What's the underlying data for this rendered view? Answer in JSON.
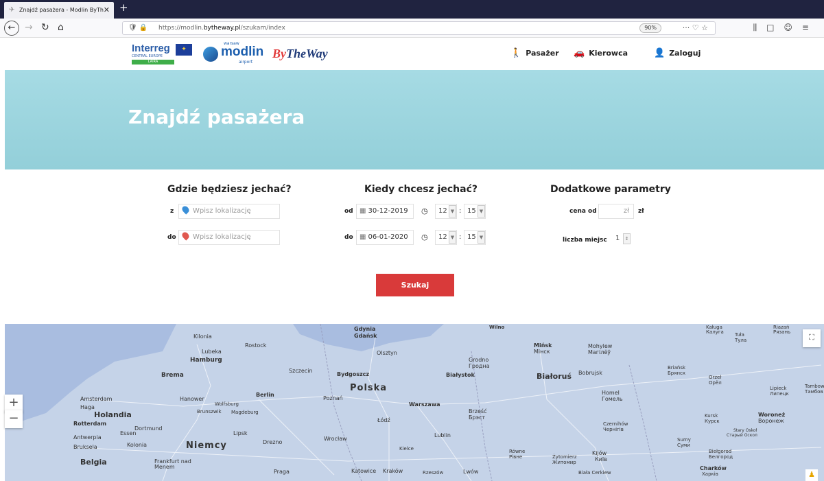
{
  "browser": {
    "tab_title": "Znajdź pasażera - Modlin ByTh",
    "url_prefix": "https://modlin.",
    "url_domain": "bytheway.pl",
    "url_path": "/szukam/index",
    "zoom": "90%"
  },
  "header": {
    "interreg_name": "Interreg",
    "interreg_sub": "CENTRAL EUROPE",
    "interreg_bar": "LAIRA",
    "modlin_top": "warsaw",
    "modlin_name": "modlin",
    "modlin_bottom": "airport",
    "btw_by": "By",
    "btw_the": "The",
    "btw_way": "Way",
    "menu": [
      {
        "label": "Pasażer",
        "icon": "walking-person-icon"
      },
      {
        "label": "Kierowca",
        "icon": "car-icon"
      },
      {
        "label": "Zaloguj",
        "icon": "user-icon"
      }
    ]
  },
  "hero": {
    "title": "Znajdź pasażera"
  },
  "search": {
    "where": {
      "title": "Gdzie będziesz jechać?",
      "from_label": "z",
      "from_placeholder": "Wpisz lokalizację",
      "to_label": "do",
      "to_placeholder": "Wpisz lokalizację"
    },
    "when": {
      "title": "Kiedy chcesz jechać?",
      "from_label": "od",
      "from_date": "30-12-2019",
      "from_hour": "12",
      "from_minute": "15",
      "to_label": "do",
      "to_date": "06-01-2020",
      "to_hour": "12",
      "to_minute": "15"
    },
    "extra": {
      "title": "Dodatkowe parametry",
      "price_label": "cena od",
      "price_placeholder": "zł",
      "price_unit": "zł",
      "seats_label": "liczba miejsc",
      "seats_value": "1"
    },
    "button": "Szukaj"
  },
  "map": {
    "zoom_in": "+",
    "zoom_out": "−",
    "cities": [
      "Gdynia",
      "Gdańsk",
      "Kilonia",
      "Rostock",
      "Lubeka",
      "Hamburg",
      "Brema",
      "Szczecin",
      "Bydgoszcz",
      "Olsztyn",
      "Grodno",
      "Гродна",
      "Mińsk",
      "Мінск",
      "Mohylew",
      "Магілёў",
      "Amsterdam",
      "Haga",
      "Holandia",
      "Rotterdam",
      "Antwerpia",
      "Bruksela",
      "Belgia",
      "Hanower",
      "Wolfsburg",
      "Brunszwik",
      "Magdeburg",
      "Berlin",
      "Poznań",
      "Polska",
      "Warszawa",
      "Białystok",
      "Białoruś",
      "Bobrujsk",
      "Homel",
      "Гомель",
      "Brześć",
      "Брэст",
      "Essen",
      "Dortmund",
      "Kolonia",
      "Niemcy",
      "Lipsk",
      "Drezno",
      "Łódź",
      "Wrocław",
      "Lublin",
      "Kielce",
      "Frankfurt nad Menem",
      "Praga",
      "Katowice",
      "Kraków",
      "Rzeszów",
      "Lwów",
      "Równe",
      "Рівне",
      "Żytomierz",
      "Житомир",
      "Kijów",
      "Київ",
      "Biała Cerkiew",
      "Czernihów",
      "Чернігів",
      "Sumy",
      "Суми",
      "Kursk",
      "Курск",
      "Biełgorod",
      "Белгород",
      "Charków",
      "Харків",
      "Woroneż",
      "Воронеж",
      "Orzeł",
      "Орёл",
      "Briańsk",
      "Брянск",
      "Lipieck",
      "Липецк",
      "Tuła",
      "Тула",
      "Kaługa",
      "Калуга",
      "Riazań",
      "Рязань",
      "Stary Oskoł",
      "Старый Оскол",
      "Tambow",
      "Тамбов",
      "Wilno"
    ]
  },
  "colors": {
    "accent_red": "#d93a3a",
    "hero_sky": "#9fd8e0",
    "map_water": "#a8bfe0",
    "tabbar": "#202340"
  }
}
